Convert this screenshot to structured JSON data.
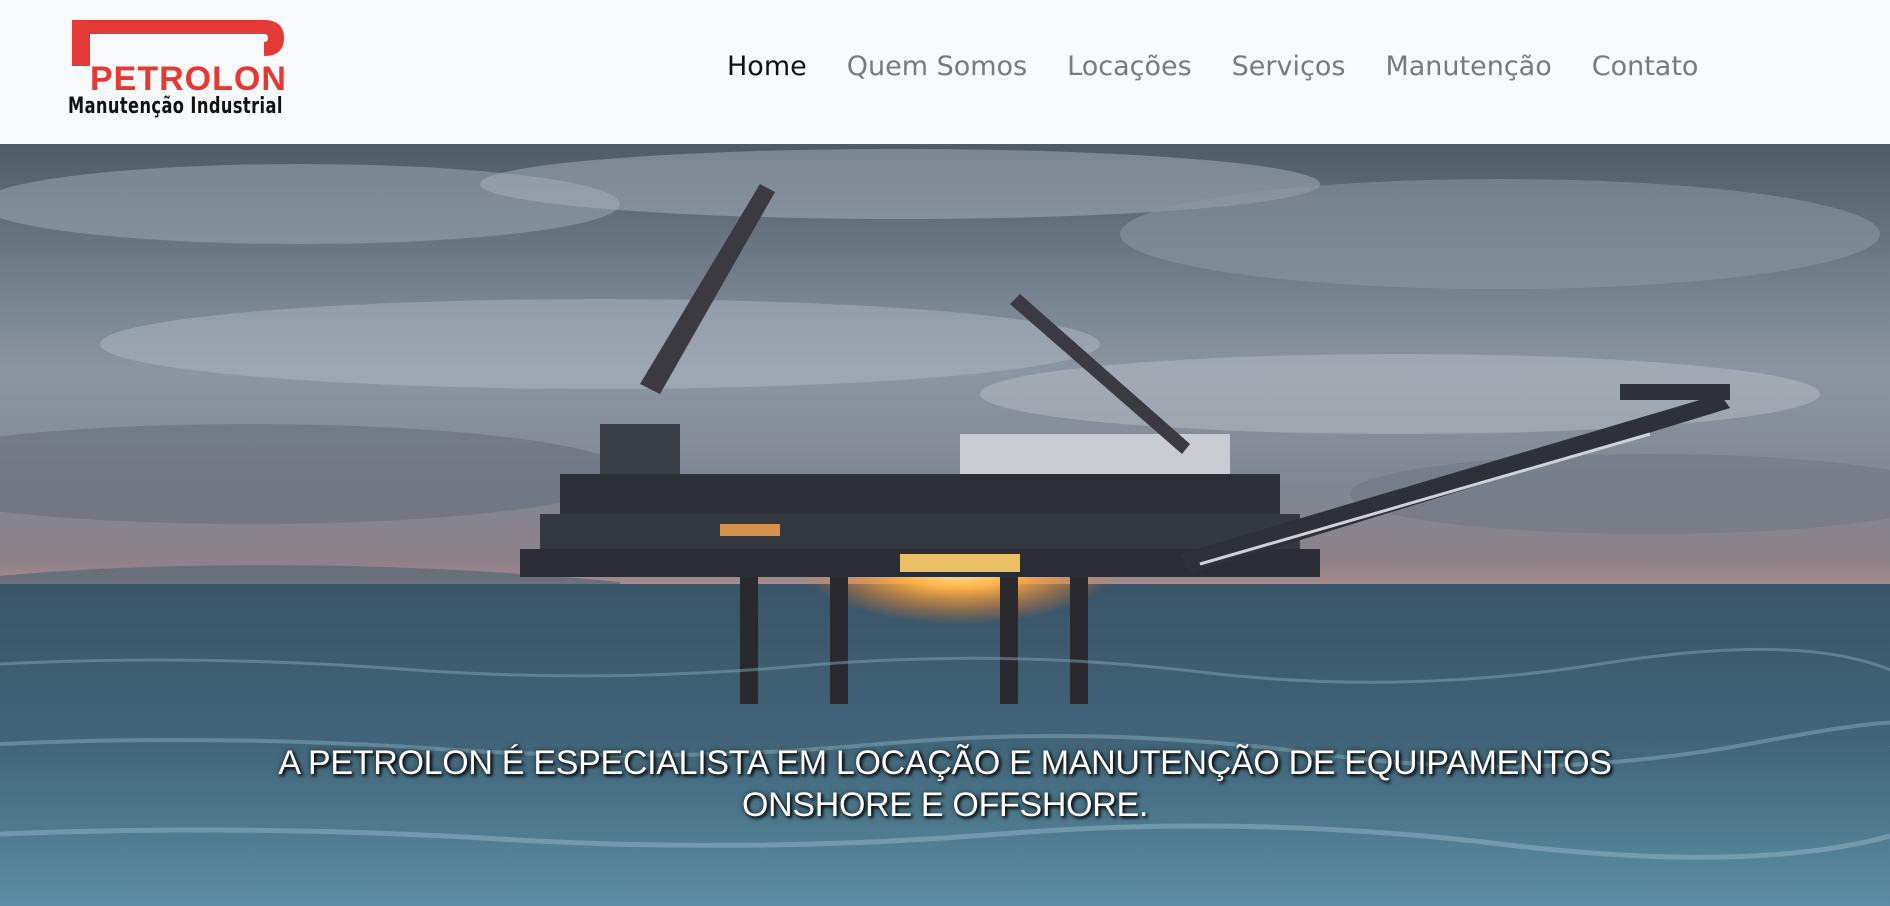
{
  "brand": {
    "name": "PETROLON",
    "tagline": "Manutenção Industrial",
    "accent_color": "#e53935"
  },
  "nav": {
    "items": [
      {
        "label": "Home",
        "active": true
      },
      {
        "label": "Quem Somos",
        "active": false
      },
      {
        "label": "Locações",
        "active": false
      },
      {
        "label": "Serviços",
        "active": false
      },
      {
        "label": "Manutenção",
        "active": false
      },
      {
        "label": "Contato",
        "active": false
      }
    ]
  },
  "hero": {
    "image": "offshore-oil-platform-at-sunset",
    "headline": "A PETROLON É ESPECIALISTA EM LOCAÇÃO E MANUTENÇÃO DE EQUIPAMENTOS ONSHORE E OFFSHORE."
  }
}
